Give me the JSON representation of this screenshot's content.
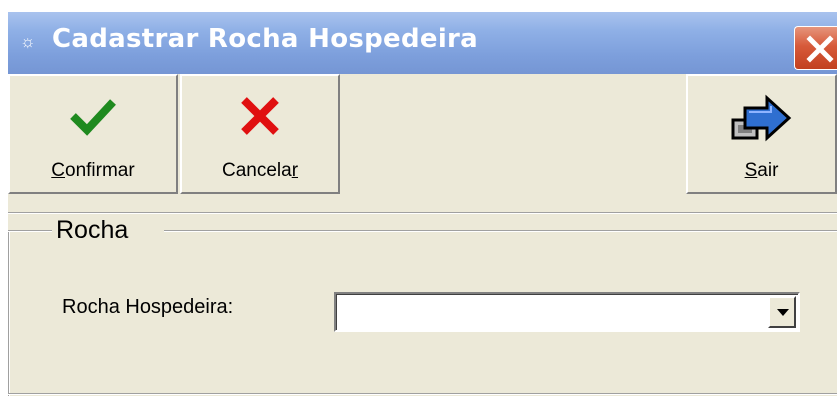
{
  "window": {
    "title": "Cadastrar Rocha Hospedeira",
    "title_icon": "app-icon",
    "close_icon": "close-icon"
  },
  "toolbar": {
    "confirm": {
      "label_mnemonic": "C",
      "label_rest": "onfirmar",
      "icon": "checkmark-icon",
      "icon_color": "#1f8a1f"
    },
    "cancel": {
      "label_rest": "Cancela",
      "label_mnemonic": "r",
      "icon": "x-icon",
      "icon_color": "#e01010"
    },
    "exit": {
      "label_mnemonic": "S",
      "label_rest": "air",
      "icon": "exit-arrow-icon",
      "icon_color": "#2f6fd0"
    }
  },
  "group": {
    "title": "Rocha"
  },
  "form": {
    "rock_label": "Rocha Hospedeira:",
    "rock_value": "",
    "dropdown_icon": "chevron-down-icon"
  }
}
